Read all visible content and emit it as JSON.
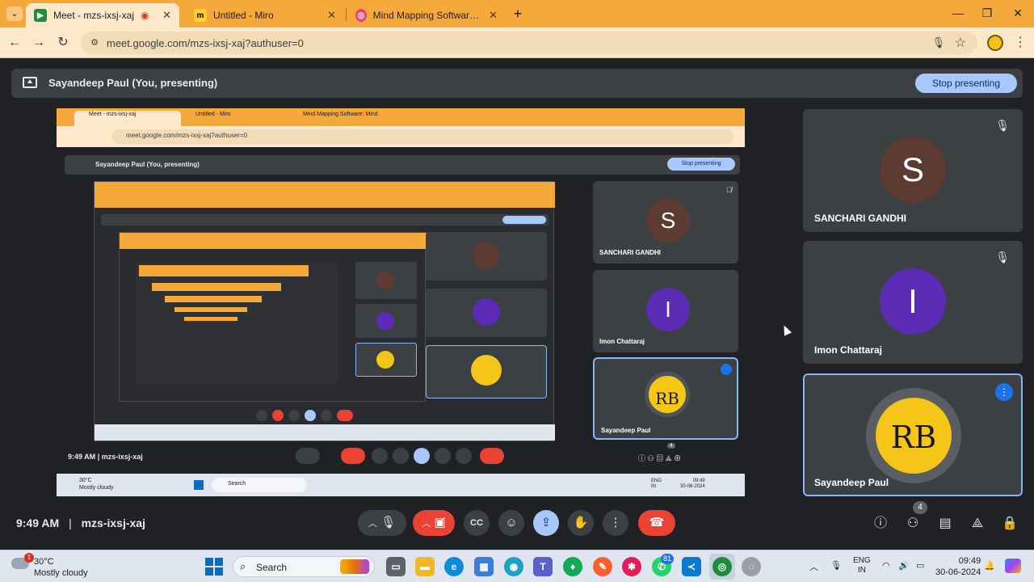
{
  "browser": {
    "tabs": [
      {
        "title": "Meet - mzs-ixsj-xaj",
        "fav": "meet-icon",
        "color": "#1e8e3e"
      },
      {
        "title": "Untitled - Miro",
        "fav": "miro-icon",
        "color": "#ffd02f"
      },
      {
        "title": "Mind Mapping Software: Mind",
        "fav": "mindmap-icon",
        "color": "#e8437b"
      }
    ],
    "url": "meet.google.com/mzs-ixsj-xaj?authuser=0"
  },
  "meet": {
    "presenting_label": "Sayandeep Paul (You, presenting)",
    "stop_presenting": "Stop presenting",
    "time": "9:49 AM",
    "separator": "|",
    "meeting_code": "mzs-ixsj-xaj",
    "participant_count": "4",
    "participants": [
      {
        "name": "SANCHARI GANDHI",
        "initial": "S",
        "color": "#5d3a32",
        "muted": true
      },
      {
        "name": "Imon Chattaraj",
        "initial": "I",
        "color": "#5b2bb5",
        "muted": true
      },
      {
        "name": "Sayandeep Paul",
        "initial": "RB",
        "color": "#f5c518",
        "speaking": true
      }
    ]
  },
  "shared_screen": {
    "tabs": [
      "Meet - mzs-ixsj-xaj",
      "Untitled - Miro",
      "Mind Mapping Software: Mind"
    ],
    "url": "meet.google.com/mzs-ixsj-xaj?authuser=0",
    "presenting_label": "Sayandeep Paul (You, presenting)",
    "stop_presenting": "Stop presenting",
    "time": "9:49 AM",
    "meeting_code": "mzs-ixsj-xaj",
    "participant_count": "4",
    "participants": [
      {
        "name": "SANCHARI GANDHI",
        "initial": "S"
      },
      {
        "name": "Imon Chattaraj",
        "initial": "I"
      },
      {
        "name": "Sayandeep Paul",
        "initial": "RB"
      }
    ],
    "weather_temp": "30°C",
    "weather_desc": "Mostly cloudy",
    "search_label": "Search",
    "lang": "ENG",
    "region": "IN",
    "clock_time": "09:49",
    "clock_date": "30-06-2024"
  },
  "taskbar": {
    "weather_temp": "30°C",
    "weather_desc": "Mostly cloudy",
    "weather_badge": "1",
    "search_label": "Search",
    "whatsapp_badge": "81",
    "lang": "ENG",
    "region": "IN",
    "clock_time": "09:49",
    "clock_date": "30-06-2024"
  }
}
